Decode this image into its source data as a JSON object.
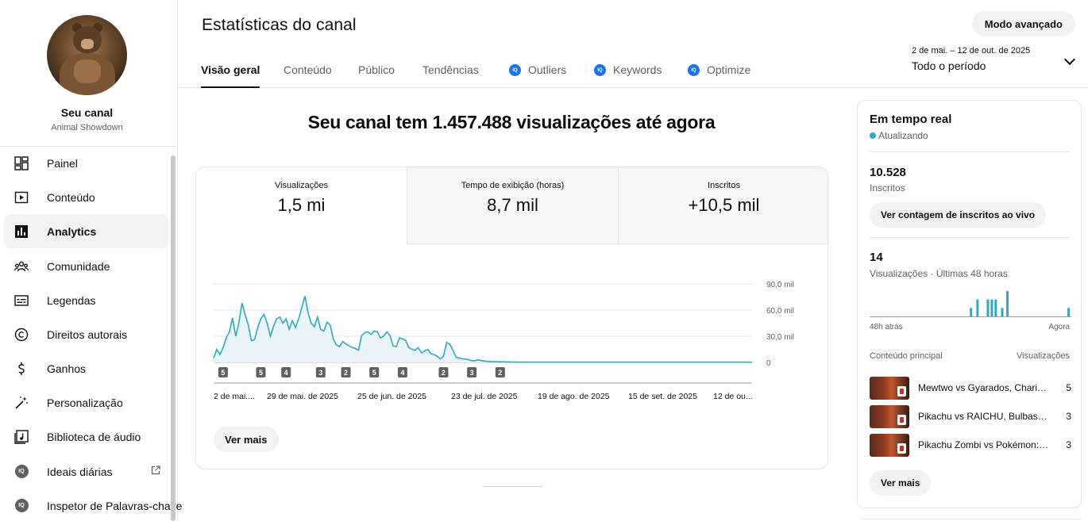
{
  "channel": {
    "name": "Seu canal",
    "subtitle": "Animal Showdown"
  },
  "sidebar": {
    "items": [
      {
        "label": "Painel",
        "icon": "dashboard-icon"
      },
      {
        "label": "Conteúdo",
        "icon": "content-icon"
      },
      {
        "label": "Analytics",
        "icon": "analytics-icon",
        "active": true
      },
      {
        "label": "Comunidade",
        "icon": "community-icon"
      },
      {
        "label": "Legendas",
        "icon": "subtitles-icon"
      },
      {
        "label": "Direitos autorais",
        "icon": "copyright-icon"
      },
      {
        "label": "Ganhos",
        "icon": "earn-icon"
      },
      {
        "label": "Personalização",
        "icon": "customization-icon"
      },
      {
        "label": "Biblioteca de áudio",
        "icon": "audio-library-icon"
      },
      {
        "label": "Ideais diárias",
        "icon": "iq-icon"
      },
      {
        "label": "Inspetor de Palavras-chave",
        "icon": "iq-icon"
      }
    ],
    "iq_badge": "IQ"
  },
  "header": {
    "title": "Estatísticas do canal",
    "advanced_button": "Modo avançado",
    "tabs": [
      {
        "label": "Visão geral",
        "active": true
      },
      {
        "label": "Conteúdo"
      },
      {
        "label": "Público"
      },
      {
        "label": "Tendências"
      },
      {
        "label": "Outliers",
        "iq": true
      },
      {
        "label": "Keywords",
        "iq": true
      },
      {
        "label": "Optimize",
        "iq": true
      }
    ],
    "iq_badge": "IQ",
    "period": {
      "range": "2 de mai. – 12 de out. de 2025",
      "label": "Todo o período"
    }
  },
  "main": {
    "headline": "Seu canal tem 1.457.488 visualizações até agora",
    "metrics": [
      {
        "label": "Visualizações",
        "value": "1,5 mi"
      },
      {
        "label": "Tempo de exibição (horas)",
        "value": "8,7 mil"
      },
      {
        "label": "Inscritos",
        "value": "+10,5 mil"
      }
    ],
    "see_more": "Ver mais"
  },
  "chart_data": {
    "type": "area",
    "y_ticks": [
      "0",
      "30,0 mil",
      "60,0 mil",
      "90,0 mil"
    ],
    "ylim": [
      0,
      90000
    ],
    "x_labels": [
      "2 de mai....",
      "29 de mai. de 2025",
      "25 de jun. de 2025",
      "23 de jul. de 2025",
      "19 de ago. de 2025",
      "15 de set. de 2025",
      "12 de ou..."
    ],
    "upload_markers": [
      {
        "day": 3,
        "count": "5"
      },
      {
        "day": 15,
        "count": "5"
      },
      {
        "day": 23,
        "count": "4"
      },
      {
        "day": 34,
        "count": "3"
      },
      {
        "day": 42,
        "count": "2"
      },
      {
        "day": 51,
        "count": "5"
      },
      {
        "day": 60,
        "count": "4"
      },
      {
        "day": 73,
        "count": "2"
      },
      {
        "day": 82,
        "count": "3"
      },
      {
        "day": 91,
        "count": "2"
      }
    ],
    "series": [
      {
        "values": [
          5000,
          15000,
          9000,
          17000,
          28000,
          35000,
          51000,
          30000,
          45000,
          68000,
          55000,
          43000,
          25000,
          26000,
          40000,
          50000,
          55000,
          45000,
          30000,
          41000,
          50000,
          52000,
          45000,
          50000,
          38000,
          48000,
          40000,
          50000,
          63000,
          76000,
          57000,
          45000,
          41000,
          52000,
          38000,
          36000,
          46000,
          43000,
          27000,
          20000,
          18000,
          24000,
          21000,
          19000,
          17000,
          16000,
          14000,
          31000,
          34000,
          35000,
          32000,
          36000,
          35000,
          28000,
          30000,
          35000,
          31000,
          19000,
          18000,
          28000,
          27000,
          25000,
          17000,
          15000,
          14000,
          17000,
          11000,
          13000,
          15000,
          10000,
          9000,
          7000,
          4000,
          7000,
          23000,
          21000,
          14000,
          6000,
          5000,
          4000,
          4000,
          3000,
          2000,
          2000,
          3000,
          2000,
          1500,
          1200,
          1000,
          900,
          800,
          700,
          600,
          500,
          500,
          400,
          400,
          300,
          300,
          300,
          300,
          300,
          300,
          300,
          300,
          300,
          300,
          300,
          300,
          300,
          300,
          300,
          300,
          300,
          300,
          300,
          300,
          300,
          300,
          300,
          300,
          300,
          300,
          300,
          300,
          300,
          300,
          300,
          300,
          300,
          300,
          300,
          300,
          300,
          300,
          300,
          300,
          300,
          300,
          300,
          300,
          300,
          300,
          300,
          300,
          300,
          300,
          300,
          300,
          300,
          300,
          300,
          300,
          300,
          300,
          300,
          300,
          300,
          300,
          300,
          300,
          300,
          300,
          300,
          300,
          300,
          300,
          300,
          300,
          300,
          300,
          300
        ]
      }
    ],
    "grid": true,
    "color": "#2fa7c6"
  },
  "realtime": {
    "title": "Em tempo real",
    "status": "Atualizando",
    "subscribers_value": "10.528",
    "subscribers_label": "Inscritos",
    "live_count_button": "Ver contagem de inscritos ao vivo",
    "views_value": "14",
    "views_label": "Visualizações · Últimas 48 horas",
    "axis_start": "48h atrás",
    "axis_end": "Agora",
    "hourly_views": [
      0,
      0,
      0,
      0,
      0,
      0,
      0,
      0,
      0,
      0,
      0,
      0,
      0,
      0,
      0,
      0,
      0,
      0,
      0,
      0,
      0,
      0,
      0,
      0,
      0,
      0,
      0,
      0,
      0,
      0,
      0,
      0,
      0,
      0,
      0,
      0,
      0,
      0,
      0,
      0,
      0,
      0,
      0,
      0,
      0,
      0,
      0,
      0,
      0,
      0,
      0,
      0,
      0,
      0,
      0,
      0,
      0,
      0,
      0,
      0,
      0,
      0,
      0,
      0,
      0,
      0,
      0,
      0,
      0,
      0,
      0,
      0,
      0,
      0,
      0,
      0,
      0,
      1,
      0,
      0,
      0,
      0,
      2,
      0,
      0,
      0,
      0,
      0,
      0,
      0,
      2,
      0,
      0,
      2,
      0,
      0,
      2,
      0,
      0,
      0,
      0,
      1,
      0,
      0,
      0,
      3,
      0,
      0,
      0,
      0,
      0,
      0,
      0,
      0,
      0,
      0,
      0,
      0,
      0,
      0,
      0,
      0,
      0,
      0,
      0,
      0,
      0,
      0,
      0,
      0,
      0,
      0,
      0,
      0,
      0,
      0,
      0,
      0,
      0,
      0,
      0,
      0,
      0,
      0,
      0,
      0,
      0,
      0,
      0,
      0,
      0,
      0,
      1,
      0,
      0
    ],
    "table_header_left": "Conteúdo principal",
    "table_header_right": "Visualizações",
    "videos": [
      {
        "title": "Mewtwo vs Gyarados, Charizard, Blastoise",
        "views": "5"
      },
      {
        "title": "Pikachu vs RAICHU, Bulbasaur, Squirtle",
        "views": "3"
      },
      {
        "title": "Pikachu Zombi vs Pokémon: Sobrevivência",
        "views": "3"
      }
    ],
    "see_more": "Ver mais"
  }
}
